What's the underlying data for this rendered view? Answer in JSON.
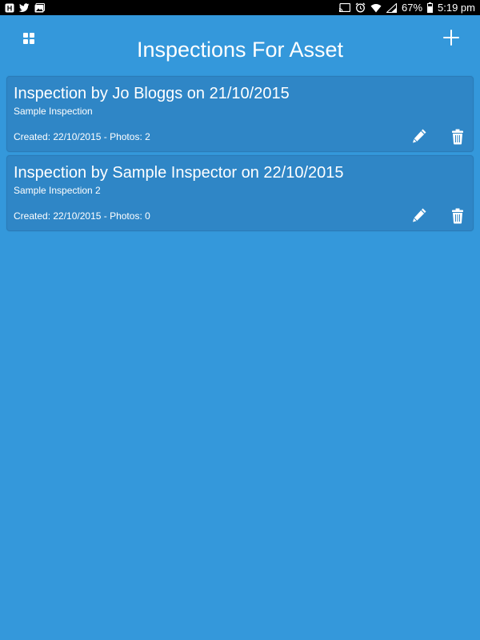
{
  "status_bar": {
    "left_icons": [
      "hp-icon",
      "twitter-icon",
      "gallery-icon"
    ],
    "right_icons": [
      "cast-icon",
      "alarm-icon",
      "wifi-icon",
      "signal-icon",
      "battery-icon"
    ],
    "battery": "67%",
    "time": "5:19 pm"
  },
  "header": {
    "title": "Inspections For Asset",
    "menu_icon": "grid-icon",
    "add_icon": "plus-icon"
  },
  "inspections": [
    {
      "title": "Inspection by Jo Bloggs on 21/10/2015",
      "subtitle": "Sample Inspection",
      "meta": "Created: 22/10/2015 - Photos: 2"
    },
    {
      "title": "Inspection by Sample Inspector on 22/10/2015",
      "subtitle": "Sample Inspection 2",
      "meta": "Created: 22/10/2015 - Photos: 0"
    }
  ],
  "colors": {
    "background": "#3498db",
    "card": "#2f86c6",
    "text": "#ffffff"
  }
}
